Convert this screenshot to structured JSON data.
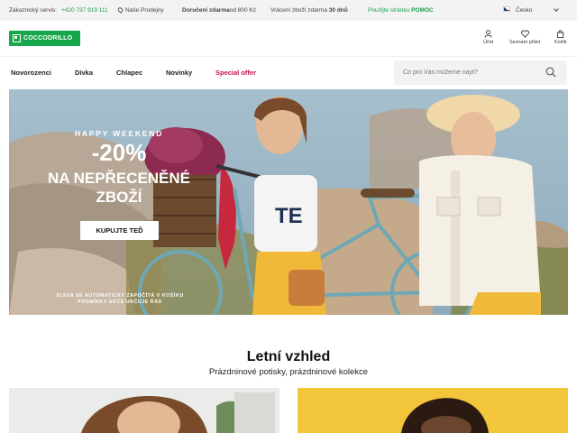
{
  "topbar": {
    "service_label": "Zákaznický servis:",
    "phone": "+420 737 919 111",
    "stores": "Naše Prodejny",
    "free_delivery_strong": "Doručení zdarma",
    "free_delivery_rest": "od 800 Kč",
    "returns_text": "Vrácení zboží zdarma",
    "returns_days": "30 dnů",
    "help_text": "Použijte stránku",
    "help_strong": "POMOC",
    "country": "Česko"
  },
  "header": {
    "logo": "COCCODRILLO",
    "account_label": "Účet",
    "wishlist_label": "Seznam přání",
    "cart_label": "Košík"
  },
  "nav": {
    "items": [
      "Novorozenci",
      "Dívka",
      "Chlapec",
      "Novinky"
    ],
    "special": "Special offer"
  },
  "search": {
    "placeholder": "Co pro Vás můžeme najít?"
  },
  "hero": {
    "line1": "HAPPY WEEKEND",
    "line2": "-20%",
    "line3a": "NA NEPŘECENĚNÉ",
    "line3b": "ZBOŽÍ",
    "button": "KUPUJTE TEĎ",
    "fine1": "SLEVA SE AUTOMATICKY ZAPOČÍTÁ V KOŠÍKU",
    "fine2": "PODMÍNKY AKCE URČUJE ŘÁD"
  },
  "section": {
    "title": "Letní vzhled",
    "subtitle": "Prázdninové potisky, prázdninové kolekce"
  },
  "colors": {
    "brand_green": "#16a64b",
    "special_offer": "#c4124f",
    "topbar_bg": "#f3f3f3"
  },
  "icons": [
    "map-pin-icon",
    "czech-flag-icon",
    "chevron-down-icon",
    "user-icon",
    "heart-icon",
    "bag-icon",
    "search-icon"
  ]
}
